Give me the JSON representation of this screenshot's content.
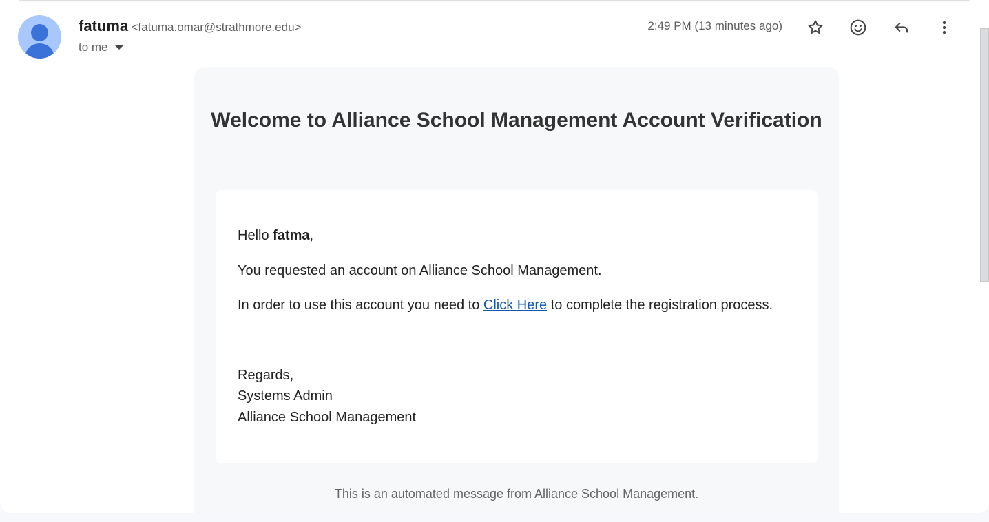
{
  "header": {
    "sender_name": "fatuma",
    "sender_email": "<fatuma.omar@strathmore.edu>",
    "recipient_label": "to me",
    "timestamp": "2:49 PM (13 minutes ago)",
    "icons": [
      "star-icon",
      "emoji-icon",
      "reply-icon",
      "more-vert-icon"
    ]
  },
  "email": {
    "title": "Welcome to Alliance School Management Account Verification",
    "greeting_prefix": "Hello ",
    "greeting_name": "fatma",
    "greeting_suffix": ",",
    "line1": "You requested an account on Alliance School Management.",
    "line2_prefix": "In order to use this account you need to ",
    "link_text": "Click Here",
    "line2_suffix": " to complete the registration process.",
    "signoff": "Regards,",
    "signature_name": "Systems Admin",
    "signature_org": "Alliance School Management",
    "footer": "This is an automated message from Alliance School Management."
  },
  "colors": {
    "avatar_bg": "#a8c7fa",
    "avatar_fg": "#3a72d9",
    "link": "#1558b0",
    "card_bg": "#f7f8fa"
  }
}
